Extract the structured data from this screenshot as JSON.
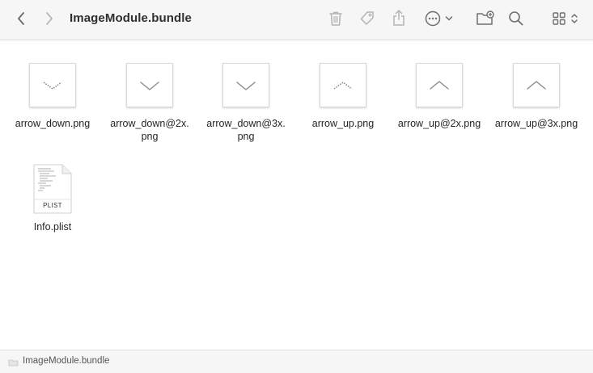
{
  "window": {
    "title": "ImageModule.bundle"
  },
  "toolbar": {
    "icons": [
      "chevron-left-icon",
      "chevron-right-icon",
      "trash-icon",
      "tag-icon",
      "share-icon",
      "more-icon",
      "chevron-down-icon",
      "new-folder-icon",
      "search-icon",
      "grid-view-icon",
      "up-down-chevron-icon"
    ]
  },
  "files": [
    {
      "name_line1": "arrow_down.png",
      "name_line2": "",
      "glyph": "chevron-down-dotted"
    },
    {
      "name_line1": "arrow_down@2x.",
      "name_line2": "png",
      "glyph": "chevron-down"
    },
    {
      "name_line1": "arrow_down@3x.",
      "name_line2": "png",
      "glyph": "chevron-down"
    },
    {
      "name_line1": "arrow_up.png",
      "name_line2": "",
      "glyph": "chevron-up-dotted"
    },
    {
      "name_line1": "arrow_up@2x.png",
      "name_line2": "",
      "glyph": "chevron-up"
    },
    {
      "name_line1": "arrow_up@3x.png",
      "name_line2": "",
      "glyph": "chevron-up"
    }
  ],
  "plist": {
    "name": "Info.plist",
    "badge": "PLIST"
  },
  "statusbar": {
    "path": "ImageModule.bundle"
  },
  "colors": {
    "toolbar_bg": "#f6f6f6",
    "icon_gray": "#6e6e6e",
    "icon_disabled": "#b4b4b4"
  }
}
